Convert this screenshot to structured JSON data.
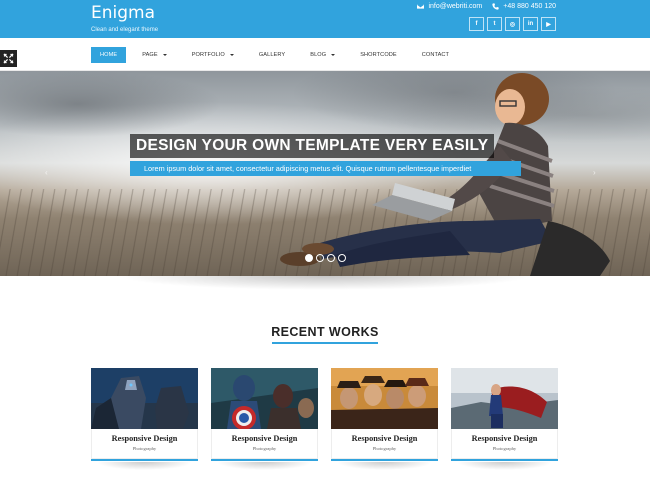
{
  "brand": {
    "title": "Enigma",
    "tagline": "Clean and elegant theme"
  },
  "contact": {
    "email": "info@webriti.com",
    "phone": "+48 880 450 120",
    "email_icon": "envelope-icon",
    "phone_icon": "phone-icon"
  },
  "socials": [
    {
      "glyph": "f",
      "icon": "facebook-icon"
    },
    {
      "glyph": "t",
      "icon": "twitter-icon"
    },
    {
      "glyph": "◎",
      "icon": "dribbble-icon"
    },
    {
      "glyph": "in",
      "icon": "linkedin-icon"
    },
    {
      "glyph": "▶",
      "icon": "youtube-icon"
    }
  ],
  "nav": [
    {
      "label": "HOME"
    },
    {
      "label": "PAGE"
    },
    {
      "label": "PORTFOLIO"
    },
    {
      "label": "GALLERY"
    },
    {
      "label": "BLOG"
    },
    {
      "label": "SHORTCODE"
    },
    {
      "label": "CONTACT"
    }
  ],
  "hero": {
    "title": "DESIGN YOUR OWN TEMPLATE VERY EASILY",
    "subtitle": "Lorem ipsum dolor sit amet, consectetur adipiscing metus elit. Quisque rutrum pellentesque imperdiet",
    "slide_count": 4,
    "active_slide": 1,
    "prev_glyph": "‹",
    "next_glyph": "›"
  },
  "recent_works": {
    "title": "RECENT WORKS",
    "items": [
      {
        "title": "Responsive Design",
        "category": "Photography"
      },
      {
        "title": "Responsive Design",
        "category": "Photography"
      },
      {
        "title": "Responsive Design",
        "category": "Photography"
      },
      {
        "title": "Responsive Design",
        "category": "Photography"
      }
    ]
  },
  "colors": {
    "accent": "#31a3dd",
    "dark": "#222222"
  }
}
